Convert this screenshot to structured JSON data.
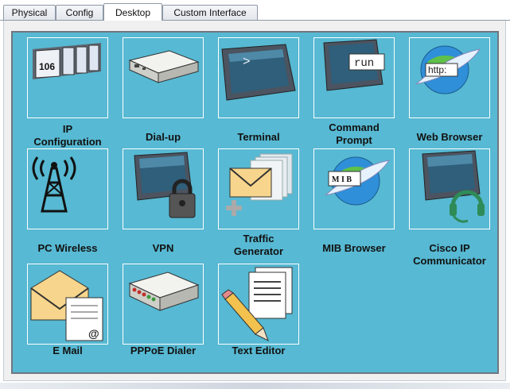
{
  "tabs": [
    {
      "label": "Physical"
    },
    {
      "label": "Config"
    },
    {
      "label": "Desktop"
    },
    {
      "label": "Custom Interface"
    }
  ],
  "active_tab": "Desktop",
  "apps": [
    {
      "label_line1": "IP",
      "label_line2": "Configuration",
      "icon": "ip-config-icon"
    },
    {
      "label_line1": "Dial-up",
      "label_line2": "",
      "icon": "dialup-modem-icon"
    },
    {
      "label_line1": "Terminal",
      "label_line2": "",
      "icon": "terminal-icon"
    },
    {
      "label_line1": "Command",
      "label_line2": "Prompt",
      "icon": "command-prompt-icon"
    },
    {
      "label_line1": "Web Browser",
      "label_line2": "",
      "icon": "web-browser-icon"
    },
    {
      "label_line1": "PC Wireless",
      "label_line2": "",
      "icon": "wireless-tower-icon"
    },
    {
      "label_line1": "VPN",
      "label_line2": "",
      "icon": "vpn-lock-icon"
    },
    {
      "label_line1": "Traffic",
      "label_line2": "Generator",
      "icon": "traffic-generator-icon"
    },
    {
      "label_line1": "MIB Browser",
      "label_line2": "",
      "icon": "mib-browser-icon"
    },
    {
      "label_line1": "Cisco IP",
      "label_line2": "Communicator",
      "icon": "ip-communicator-icon"
    },
    {
      "label_line1": "E Mail",
      "label_line2": "",
      "icon": "email-icon"
    },
    {
      "label_line1": "PPPoE Dialer",
      "label_line2": "",
      "icon": "pppoe-dialer-icon"
    },
    {
      "label_line1": "Text Editor",
      "label_line2": "",
      "icon": "text-editor-icon"
    }
  ],
  "icon_text": {
    "ip": "106",
    "terminal": ">",
    "run": "run",
    "http": "http:",
    "mib": "M I B",
    "at": "@"
  },
  "colors": {
    "desktop_bg": "#57b9d3",
    "panel_border": "#6f7780"
  }
}
